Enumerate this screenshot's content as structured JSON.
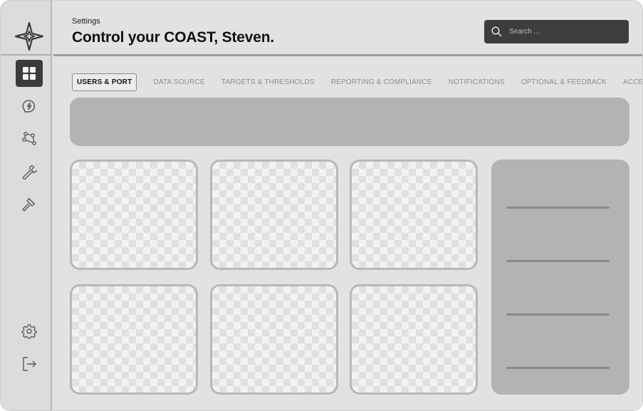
{
  "header": {
    "breadcrumb": "Settings",
    "title": "Control your COAST, Steven."
  },
  "search": {
    "placeholder": "Search ...",
    "icon": "search-icon"
  },
  "sidebar": {
    "logo_icon": "compass-star-icon",
    "items": [
      {
        "name": "dashboard",
        "icon": "grid-icon",
        "active": true
      },
      {
        "name": "energy",
        "icon": "lightning-icon",
        "active": false
      },
      {
        "name": "network",
        "icon": "nodes-icon",
        "active": false
      },
      {
        "name": "tools",
        "icon": "wrench-icon",
        "active": false
      },
      {
        "name": "compliance",
        "icon": "gavel-icon",
        "active": false
      }
    ],
    "bottom_items": [
      {
        "name": "settings",
        "icon": "gear-icon"
      },
      {
        "name": "logout",
        "icon": "logout-icon"
      }
    ]
  },
  "tabs": [
    {
      "label": "USERS & PORT",
      "active": true
    },
    {
      "label": "DATA SOURCE",
      "active": false
    },
    {
      "label": "TARGETS & THRESHOLDS",
      "active": false
    },
    {
      "label": "REPORTING & COMPLIANCE",
      "active": false
    },
    {
      "label": "NOTIFICATIONS",
      "active": false
    },
    {
      "label": "OPTIONAL & FEEDBACK",
      "active": false
    },
    {
      "label": "ACCESSIBLITY",
      "active": false
    }
  ],
  "colors": {
    "active_nav": "#3b3b3b",
    "search_bg": "#3d3d3d",
    "placeholder_block": "#b3b3b3"
  }
}
